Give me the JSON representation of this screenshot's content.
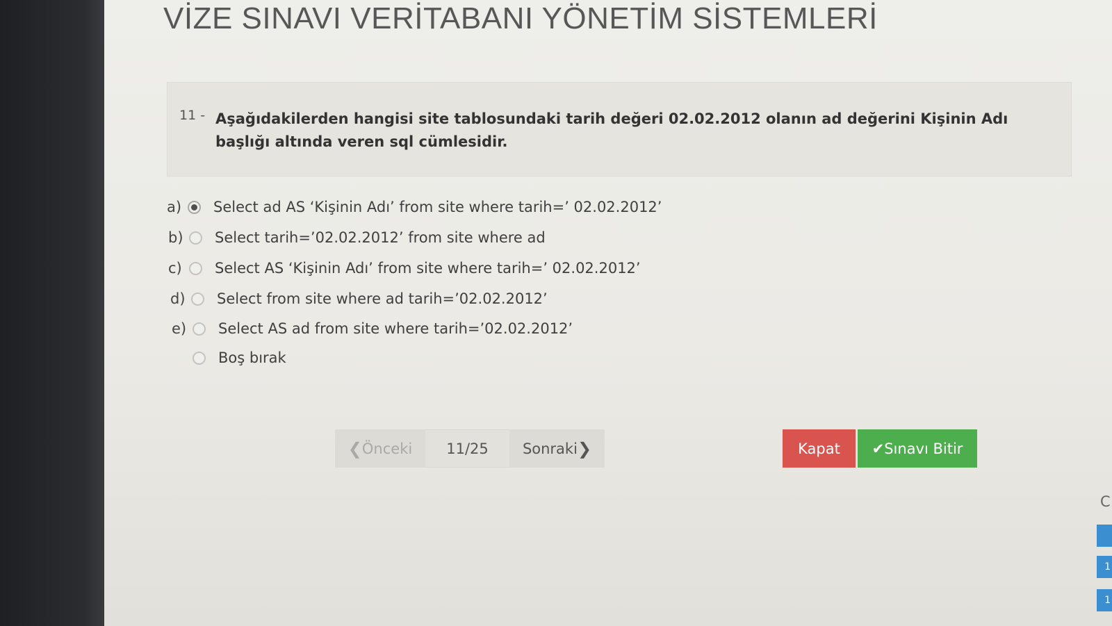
{
  "exam": {
    "title": "VİZE SINAVI VERİTABANI YÖNETİM SİSTEMLERİ"
  },
  "question": {
    "number": "11 -",
    "text": "Aşağıdakilerden hangisi site tablosundaki tarih değeri 02.02.2012 olanın ad değerini Kişinin Adı başlığı altında veren sql cümlesidir."
  },
  "options": [
    {
      "letter": "a)",
      "text": "Select ad AS ‘Kişinin Adı’ from site where tarih=’ 02.02.2012’",
      "selected": true
    },
    {
      "letter": "b)",
      "text": "Select tarih=’02.02.2012’ from site where ad",
      "selected": false
    },
    {
      "letter": "c)",
      "text": "Select AS ‘Kişinin Adı’ from site where tarih=’ 02.02.2012’",
      "selected": false
    },
    {
      "letter": "d)",
      "text": "Select from site where ad tarih=’02.02.2012’",
      "selected": false
    },
    {
      "letter": "e)",
      "text": "Select AS ad from site where tarih=’02.02.2012’",
      "selected": false
    },
    {
      "letter": "",
      "text": "Boş bırak",
      "selected": false
    }
  ],
  "navigation": {
    "prev_label": "Önceki",
    "counter": "11/25",
    "next_label": "Sonraki"
  },
  "actions": {
    "close_label": "Kapat",
    "finish_label": "Sınavı Bitir"
  },
  "side_panel": {
    "letter": "C",
    "tabs": [
      "",
      "1",
      "1"
    ]
  },
  "colors": {
    "close_button": "#d9534f",
    "finish_button": "#4cae4c",
    "side_tab": "#3b8fd0"
  }
}
